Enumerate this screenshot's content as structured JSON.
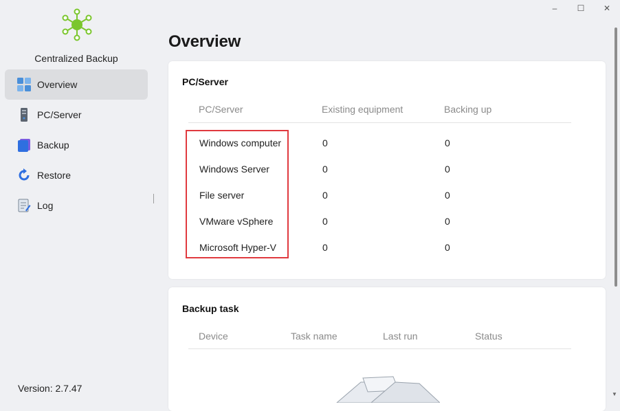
{
  "window": {
    "minimize": "–",
    "maximize": "☐",
    "close": "✕"
  },
  "sidebar": {
    "app_title": "Centralized Backup",
    "items": [
      {
        "label": "Overview",
        "icon": "overview-icon",
        "active": true
      },
      {
        "label": "PC/Server",
        "icon": "server-icon",
        "active": false
      },
      {
        "label": "Backup",
        "icon": "backup-icon",
        "active": false
      },
      {
        "label": "Restore",
        "icon": "restore-icon",
        "active": false
      },
      {
        "label": "Log",
        "icon": "log-icon",
        "active": false
      }
    ],
    "version": "Version: 2.7.47"
  },
  "main": {
    "title": "Overview",
    "pc_server_card": {
      "title": "PC/Server",
      "columns": [
        "PC/Server",
        "Existing equipment",
        "Backing up"
      ],
      "rows": [
        [
          "Windows computer",
          "0",
          "0"
        ],
        [
          "Windows Server",
          "0",
          "0"
        ],
        [
          "File server",
          "0",
          "0"
        ],
        [
          "VMware vSphere",
          "0",
          "0"
        ],
        [
          "Microsoft Hyper-V",
          "0",
          "0"
        ]
      ]
    },
    "backup_task_card": {
      "title": "Backup task",
      "columns": [
        "Device",
        "Task name",
        "Last run",
        "Status"
      ]
    }
  },
  "colors": {
    "accent_green": "#7bc62d",
    "highlight_red": "#e0393e",
    "active_nav_bg": "#dcdde0"
  }
}
